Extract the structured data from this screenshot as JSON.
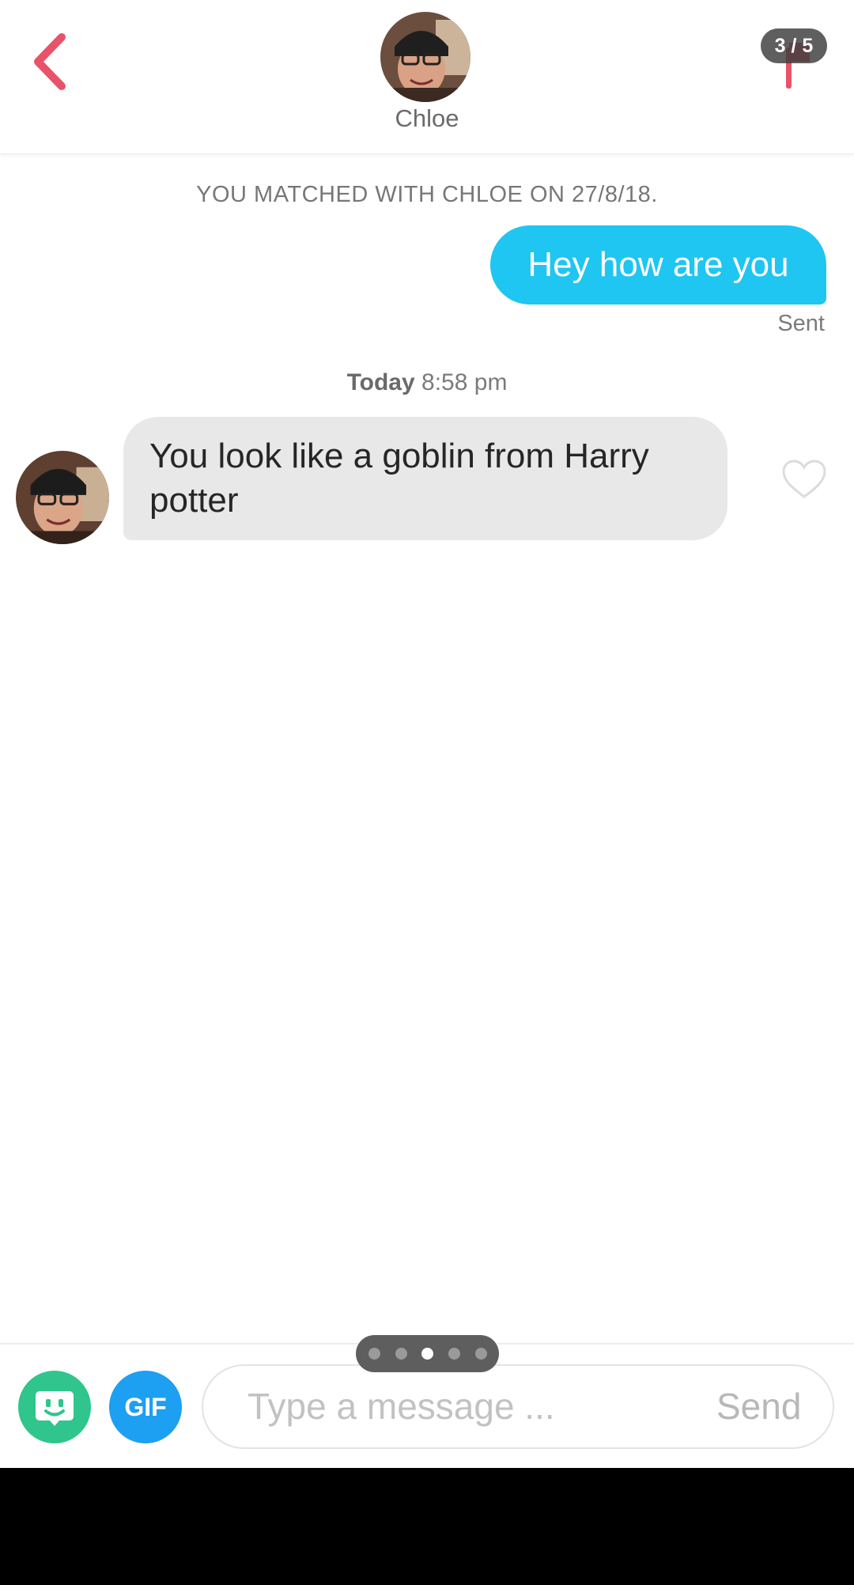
{
  "header": {
    "contact_name": "Chloe",
    "page_indicator": "3 / 5"
  },
  "chat": {
    "match_notice": "YOU MATCHED WITH CHLOE ON 27/8/18.",
    "sent_message": "Hey how are you",
    "sent_status": "Sent",
    "time_day": "Today",
    "time_clock": "8:58 pm",
    "received_message": "You look like a goblin from Harry potter"
  },
  "composer": {
    "gif_label": "GIF",
    "placeholder": "Type a message ...",
    "send_label": "Send"
  },
  "pager": {
    "total": 5,
    "active_index": 2
  },
  "colors": {
    "back_arrow": "#e8536a",
    "sent_bubble": "#1ec6f1",
    "received_bubble": "#e8e8e8",
    "bitmoji_button": "#2fc58c",
    "gif_button": "#1d9ff2",
    "report_icon": "#e8536a"
  },
  "icons": {
    "back": "chevron-left-icon",
    "report": "flag-icon",
    "like": "heart-outline-icon",
    "bitmoji": "bitmoji-face-icon"
  }
}
